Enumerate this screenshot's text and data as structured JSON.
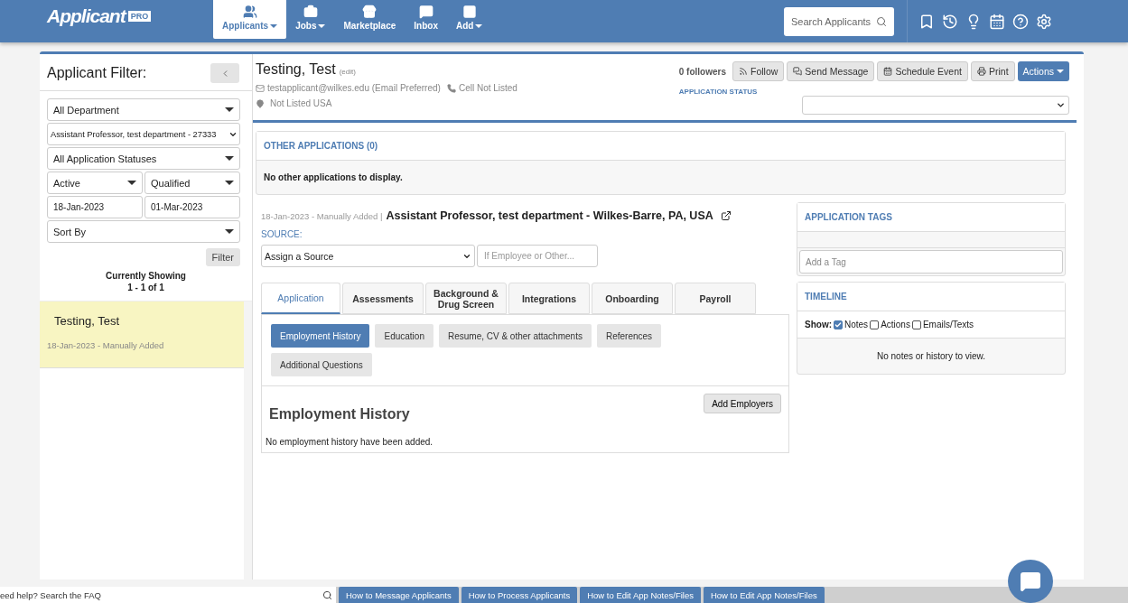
{
  "nav": {
    "logo": "Applicant",
    "logo_badge": "PRO",
    "items": [
      {
        "label": "Applicants",
        "dropdown": true,
        "selected": true
      },
      {
        "label": "Jobs",
        "dropdown": true,
        "selected": false
      },
      {
        "label": "Marketplace",
        "dropdown": false,
        "selected": false
      },
      {
        "label": "Inbox",
        "dropdown": false,
        "selected": false
      },
      {
        "label": "Add",
        "dropdown": true,
        "selected": false
      }
    ],
    "search": {
      "placeholder": "Search Applicants"
    }
  },
  "filter": {
    "title": "Applicant Filter:",
    "rows": [
      [
        {
          "kind": "select",
          "value": "All Department"
        }
      ],
      [
        {
          "kind": "native",
          "value": "Assistant Professor, test department - 27333"
        }
      ],
      [
        {
          "kind": "select",
          "value": "All Application Statuses"
        }
      ],
      [
        {
          "kind": "select",
          "value": "Active"
        },
        {
          "kind": "select",
          "value": "Qualified"
        }
      ],
      [
        {
          "kind": "date",
          "value": "18-Jan-2023"
        },
        {
          "kind": "date",
          "value": "01-Mar-2023"
        }
      ],
      [
        {
          "kind": "select",
          "value": "Sort By"
        }
      ]
    ],
    "button": "Filter",
    "showing": "Currently Showing",
    "range": "1 - 1 of 1",
    "results": [
      {
        "name": "Testing, Test",
        "meta": "18-Jan-2023 - Manually Added",
        "selected": true
      }
    ]
  },
  "applicant": {
    "name": "Testing, Test",
    "edit": "(edit)",
    "email": "testapplicant@wilkes.edu (Email Preferred)",
    "phone": "Cell Not Listed",
    "location": "Not Listed USA",
    "followers": "0 followers",
    "actions": [
      {
        "label": "Follow",
        "kind": "default"
      },
      {
        "label": "Send Message",
        "kind": "default"
      },
      {
        "label": "Schedule Event",
        "kind": "default"
      },
      {
        "label": "Print",
        "kind": "default"
      },
      {
        "label": "Actions",
        "kind": "primary"
      }
    ],
    "status_label": "APPLICATION STATUS"
  },
  "other_applications": {
    "title": "OTHER APPLICATIONS (0)",
    "empty": "No other applications to display."
  },
  "application": {
    "date": "18-Jan-2023 - Manually Added |",
    "position": "Assistant Professor, test department - Wilkes-Barre, PA, USA",
    "source_label": "SOURCE:",
    "source": "Assign a Source",
    "other_placeholder": "If Employee or Other...",
    "tabs": [
      {
        "label": "Application",
        "selected": true
      },
      {
        "label": "Assessments",
        "selected": false
      },
      {
        "label": "Background & Drug Screen",
        "selected": false
      },
      {
        "label": "Integrations",
        "selected": false
      },
      {
        "label": "Onboarding",
        "selected": false
      },
      {
        "label": "Payroll",
        "selected": false
      }
    ],
    "subtabs": [
      {
        "label": "Employment History",
        "selected": true
      },
      {
        "label": "Education",
        "selected": false
      },
      {
        "label": "Resume, CV & other attachments",
        "selected": false
      },
      {
        "label": "References",
        "selected": false
      },
      {
        "label": "Additional Questions",
        "selected": false
      }
    ],
    "section_title": "Employment History",
    "add_button": "Add Employers",
    "empty": "No employment history have been added."
  },
  "tags": {
    "title": "APPLICATION TAGS",
    "placeholder": "Add a Tag"
  },
  "timeline": {
    "title": "TIMELINE",
    "show": "Show:",
    "filters": [
      {
        "label": "Notes",
        "checked": true
      },
      {
        "label": "Actions",
        "checked": false
      },
      {
        "label": "Emails/Texts",
        "checked": false
      }
    ],
    "empty": "No notes or history to view."
  },
  "footer": {
    "faq_placeholder": "eed help? Search the FAQ",
    "links": [
      "How to Message Applicants",
      "How to Process Applicants",
      "How to Edit App Notes/Files",
      "How to Edit App Notes/Files"
    ]
  }
}
